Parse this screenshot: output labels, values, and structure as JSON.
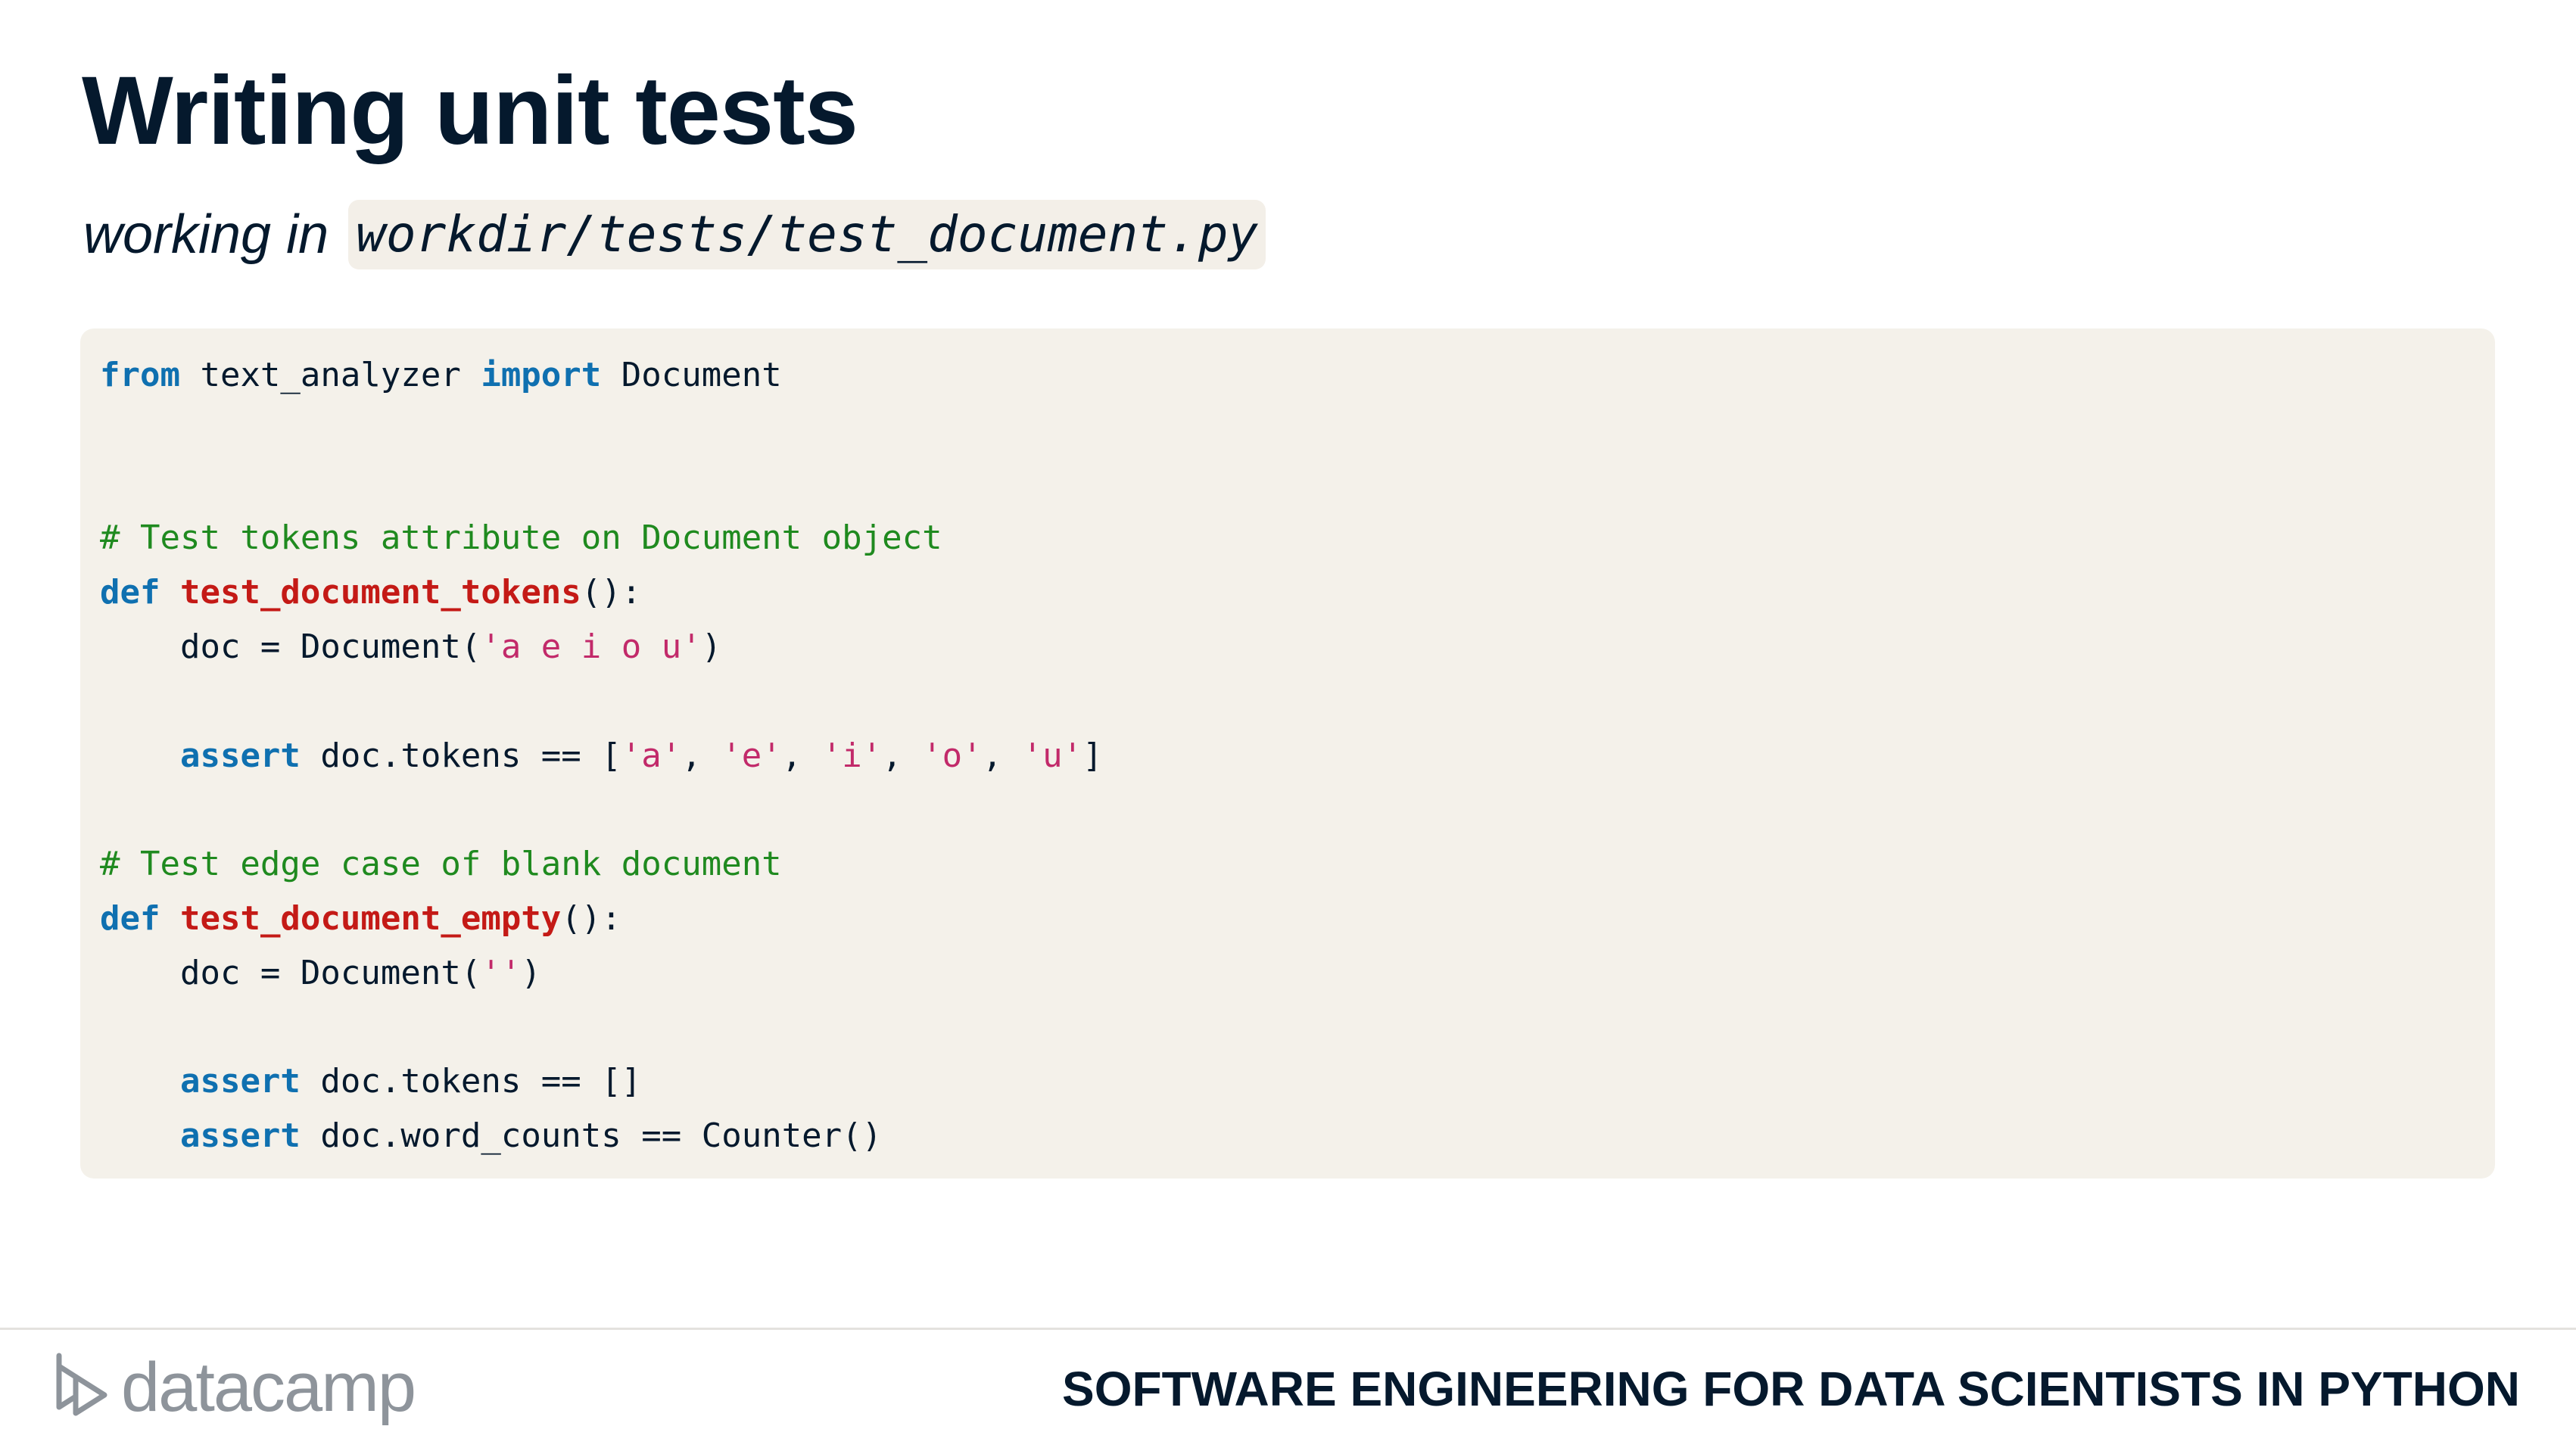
{
  "slide": {
    "title": "Writing unit tests",
    "subtitle_prefix": "working in",
    "subtitle_path": "workdir/tests/test_document.py"
  },
  "code": {
    "line1": {
      "kw1": "from",
      "t1": " text_analyzer ",
      "kw2": "import",
      "t2": " Document"
    },
    "comment1": "# Test tokens attribute on Document object",
    "def1": {
      "kw": "def",
      "fn": "test_document_tokens",
      "rest": "():"
    },
    "line_doc1": {
      "pre": "    doc = Document(",
      "str": "'a e i o u'",
      "post": ")"
    },
    "assert1": {
      "kw": "assert",
      "pre": " doc.tokens == [",
      "s1": "'a'",
      "c1": ", ",
      "s2": "'e'",
      "c2": ", ",
      "s3": "'i'",
      "c3": ", ",
      "s4": "'o'",
      "c4": ", ",
      "s5": "'u'",
      "post": "]"
    },
    "comment2": "# Test edge case of blank document",
    "def2": {
      "kw": "def",
      "fn": "test_document_empty",
      "rest": "():"
    },
    "line_doc2": {
      "pre": "    doc = Document(",
      "str": "''",
      "post": ")"
    },
    "assert2": {
      "kw": "assert",
      "rest": " doc.tokens == []"
    },
    "assert3": {
      "kw": "assert",
      "rest": " doc.word_counts == Counter()"
    }
  },
  "footer": {
    "logo_text": "datacamp",
    "course_name": "SOFTWARE ENGINEERING FOR DATA SCIENTISTS IN PYTHON"
  },
  "colors": {
    "keyword": "#0f70b0",
    "function": "#c41a16",
    "string": "#c22a6a",
    "comment": "#1f8a1f",
    "code_bg": "#f4f1ea",
    "text": "#05192d"
  }
}
